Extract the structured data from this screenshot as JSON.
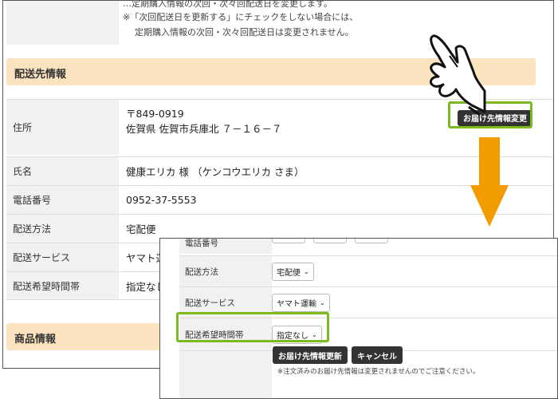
{
  "top_notes": {
    "line1": "…定期購入情報の次回・次々回配送日を変更します。",
    "line2": "※「次回配送日を更新する」にチェックをしない場合には、",
    "line3": "定期購入情報の次回・次々回配送日は変更されません。"
  },
  "sections": {
    "delivery_title": "配送先情報",
    "product_title": "商品情報"
  },
  "delivery": {
    "address_label": "住所",
    "postal": "〒849-0919",
    "address": "佐賀県 佐賀市兵庫北 ７－１６－７",
    "change_button": "お届け先情報変更",
    "name_label": "氏名",
    "name_value": "健康エリカ 様 （ケンコウエリカ さま）",
    "phone_label": "電話番号",
    "phone_value": "0952-37-5553",
    "method_label": "配送方法",
    "method_value": "宅配便",
    "service_label": "配送サービス",
    "service_value": "ヤマト運",
    "time_label": "配送希望時間帯",
    "time_value": "指定なし"
  },
  "edit_form": {
    "phone_label_cut": "電話番号",
    "method_label": "配送方法",
    "method_select": "宅配便",
    "service_label": "配送サービス",
    "service_select": "ヤマト運輸",
    "time_label": "配送希望時間帯",
    "time_select": "指定なし",
    "update_button": "お届け先情報更新",
    "cancel_button": "キャンセル",
    "notice": "※注文済みのお届け先情報は変更されませんのでご注意ください。"
  },
  "icons": {
    "pointer": "hand-pointer-icon",
    "arrow": "arrow-down-icon",
    "select": "chevron-down-icon"
  },
  "colors": {
    "section_bg": "#fbe3c0",
    "highlight": "#7cbb1f",
    "arrow": "#f39c00",
    "button": "#333333"
  }
}
